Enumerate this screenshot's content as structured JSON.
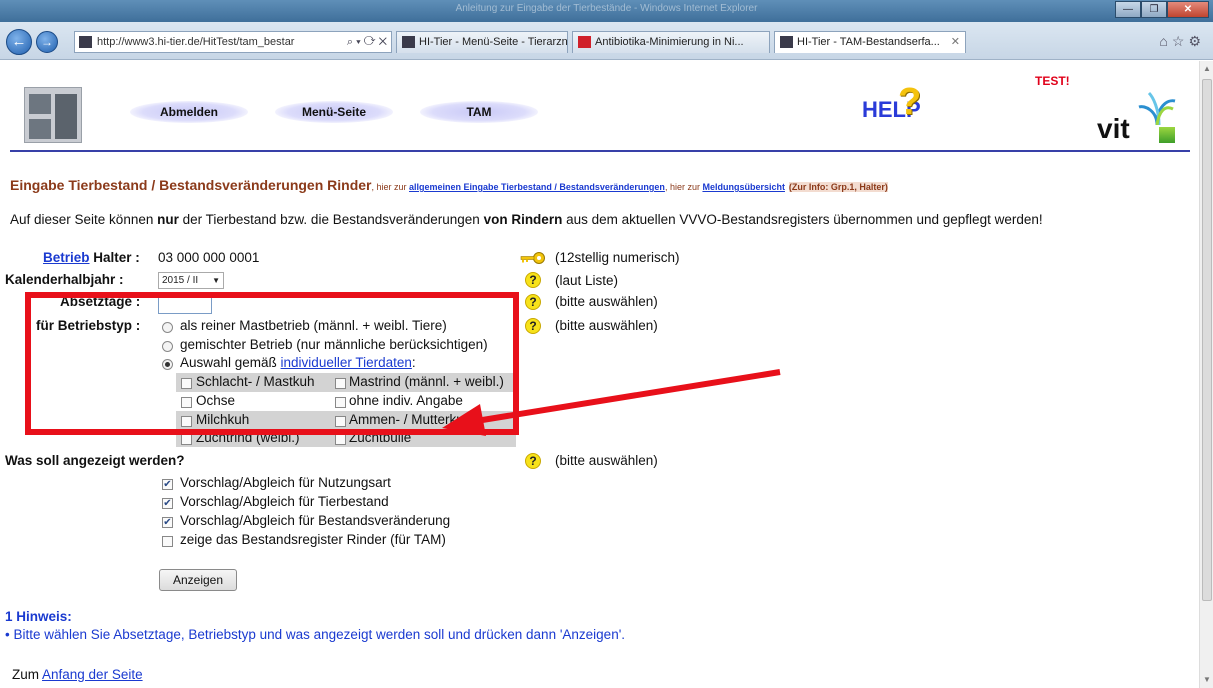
{
  "browser": {
    "window_title": "Anleitung zur Eingabe der Tierbestände - Windows Internet Explorer",
    "url": "http://www3.hi-tier.de/HitTest/tam_bestar",
    "tabs": [
      {
        "label": "HI-Tier - Menü-Seite - Tierarzn..."
      },
      {
        "label": "Antibiotika-Minimierung in Ni..."
      },
      {
        "label": "HI-Tier - TAM-Bestandserfa..."
      }
    ]
  },
  "header": {
    "nav": {
      "logout": "Abmelden",
      "menu": "Menü-Seite",
      "tam": "TAM"
    },
    "help": "HELP",
    "test_label": "TEST!",
    "vit": "vit"
  },
  "title": {
    "main": "Eingabe Tierbestand / Bestandsveränderungen Rinder",
    "pre_link1": ", hier zur ",
    "link1": "allgemeinen Eingabe Tierbestand / Bestandsveränderungen",
    "pre_link2": ", hier zur ",
    "link2": "Meldungsübersicht",
    "info": "(Zur Info: Grp.1, Halter)"
  },
  "intro": {
    "p1": "Auf dieser Seite können ",
    "b1": "nur",
    "p2": " der Tierbestand bzw. die Bestandsveränderungen ",
    "b2": "von Rindern",
    "p3": " aus dem aktuellen VVVO-Bestandsregisters übernommen und gepflegt werden!"
  },
  "form": {
    "betrieb_link": "Betrieb",
    "betrieb_label": "Halter :",
    "betrieb_value": "03 000 000 0001",
    "betrieb_hint": "(12stellig numerisch)",
    "kalender_label": "Kalenderhalbjahr :",
    "kalender_value": "2015 / II",
    "kalender_hint": "(laut Liste)",
    "absetztage_label": "Absetztage :",
    "absetztage_value": "",
    "absetztage_hint": "(bitte auswählen)",
    "betriebstyp_label": "für Betriebstyp :",
    "betriebstyp_hint": "(bitte auswählen)",
    "radio1": "als reiner Mastbetrieb (männl. + weibl. Tiere)",
    "radio2": "gemischter Betrieb (nur männliche berücksichtigen)",
    "radio3_pre": "Auswahl gemäß ",
    "radio3_link": "individueller Tierdaten",
    "radio3_post": ":",
    "checkboxes": [
      "Schlacht- / Mastkuh",
      "Mastrind (männl. + weibl.)",
      "Ochse",
      "ohne indiv. Angabe",
      "Milchkuh",
      "Ammen- / Mutterkuh",
      "Zuchtrind (weibl.)",
      "Zuchtbulle"
    ],
    "was_label": "Was soll angezeigt werden?",
    "was_hint": "(bitte auswählen)",
    "options": [
      {
        "label": "Vorschlag/Abgleich für Nutzungsart",
        "checked": true
      },
      {
        "label": "Vorschlag/Abgleich für Tierbestand",
        "checked": true
      },
      {
        "label": "Vorschlag/Abgleich für Bestandsveränderung",
        "checked": true
      },
      {
        "label": "zeige das Bestandsregister Rinder (für TAM)",
        "checked": false
      }
    ],
    "submit": "Anzeigen"
  },
  "hinweis": {
    "title": "1 Hinweis:",
    "text": "• Bitte wählen Sie Absetztage, Betriebstyp und was angezeigt werden soll und drücken dann 'Anzeigen'."
  },
  "footer": {
    "pre": "Zum ",
    "link": "Anfang der Seite"
  },
  "colors": {
    "annotation": "#e8101a",
    "link": "#1a3ad0",
    "heading": "#8b3a1a"
  }
}
